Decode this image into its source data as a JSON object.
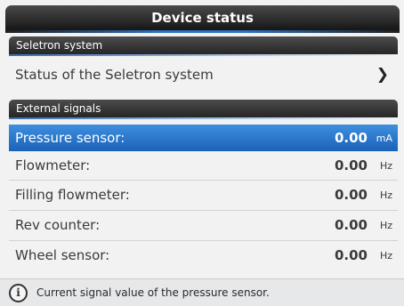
{
  "window": {
    "title": "Device status"
  },
  "sections": [
    {
      "header": "Seletron system",
      "items": [
        {
          "label": "Status of the Seletron system",
          "icon": "chevron-right-icon"
        }
      ]
    },
    {
      "header": "External signals",
      "items": [
        {
          "label": "Pressure sensor:",
          "value": "0.00",
          "unit": "mA",
          "selected": true
        },
        {
          "label": "Flowmeter:",
          "value": "0.00",
          "unit": "Hz"
        },
        {
          "label": "Filling flowmeter:",
          "value": "0.00",
          "unit": "Hz"
        },
        {
          "label": "Rev counter:",
          "value": "0.00",
          "unit": "Hz"
        },
        {
          "label": "Wheel sensor:",
          "value": "0.00",
          "unit": "Hz"
        }
      ]
    }
  ],
  "info_bar": {
    "icon": "info-icon",
    "text": "Current signal value of the pressure sensor."
  },
  "colors": {
    "selection": "#2a78d0",
    "header": "#2e2e2e",
    "accent": "#2e73c0"
  }
}
